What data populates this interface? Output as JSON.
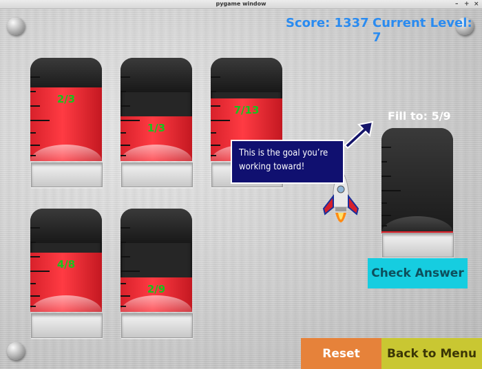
{
  "window": {
    "title": "pygame window",
    "controls": [
      "–",
      "+",
      "×"
    ]
  },
  "hud": {
    "score": "Score: 1337",
    "level": "Current Level: 7"
  },
  "beakers": [
    {
      "label": "2/3",
      "level": 0.667
    },
    {
      "label": "1/3",
      "level": 0.333
    },
    {
      "label": "7/13",
      "level": 0.538
    },
    {
      "label": "4/8",
      "level": 0.5
    },
    {
      "label": "2/9",
      "level": 0.222
    }
  ],
  "target": {
    "label": "Fill to: 5/9",
    "level": 0.0
  },
  "tooltip": {
    "text": "This is the goal you’re working toward!"
  },
  "buttons": {
    "check": "Check Answer",
    "reset": "Reset",
    "menu": "Back to Menu"
  },
  "colors": {
    "hud": "#2a8bf0",
    "fraction": "#17c41d",
    "fill": "#e0222b",
    "check": "#16cde0",
    "reset": "#e6823a",
    "menu": "#c9c732",
    "tooltip": "#101070"
  },
  "icons": [
    "rivet-icon",
    "arrow-icon",
    "rocket-icon"
  ]
}
